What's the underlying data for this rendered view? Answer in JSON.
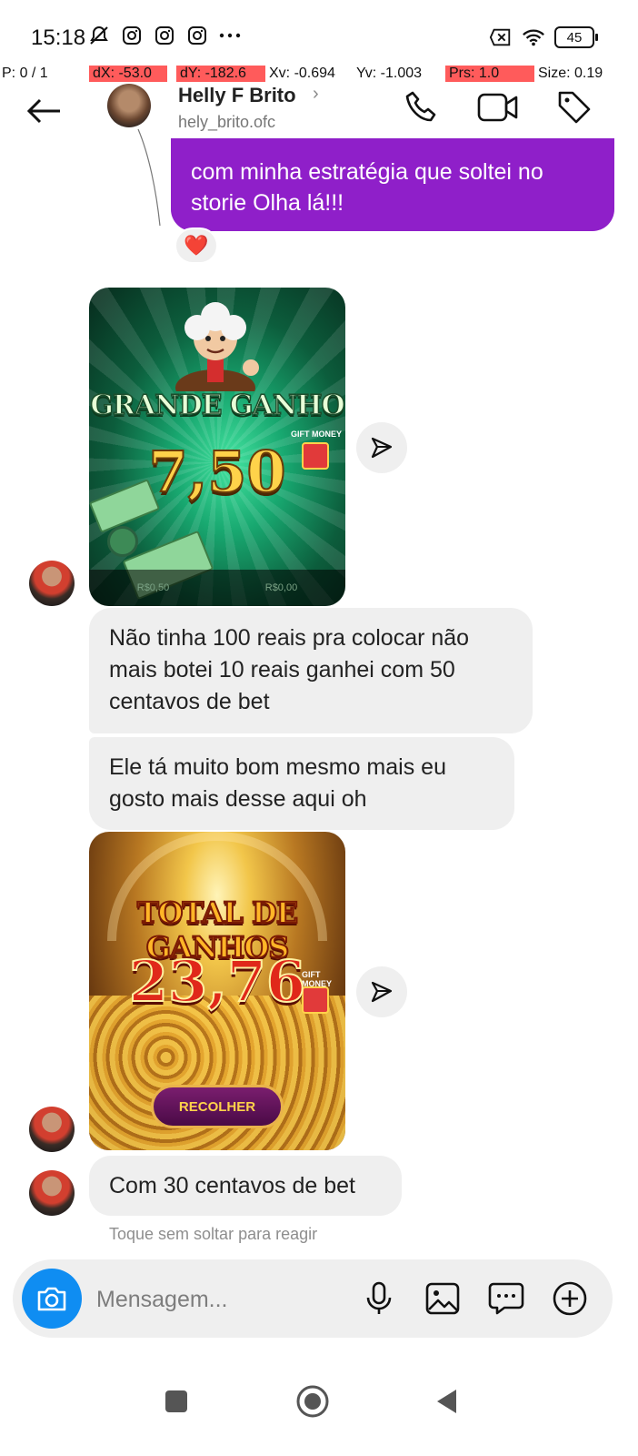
{
  "status_bar": {
    "time": "15:18",
    "battery": "45",
    "icons_left": [
      "notifications-off-icon",
      "instagram-icon",
      "instagram-icon",
      "instagram-icon",
      "more-dots-icon"
    ],
    "icons_right": [
      "sim-off-icon",
      "wifi-icon",
      "battery-icon"
    ]
  },
  "pointer_debug": {
    "p": "P: 0 / 1",
    "dx": "dX: -53.0",
    "dy": "dY: -182.6",
    "xv": "Xv: -0.694",
    "yv": "Yv: -1.003",
    "prs": "Prs: 1.0",
    "size": "Size: 0.19"
  },
  "header": {
    "name": "Helly F Brito",
    "chevron": "›",
    "handle": "hely_brito.ofc",
    "actions": [
      "phone-icon",
      "video-call-icon",
      "tag-icon"
    ]
  },
  "messages": {
    "outgoing_text": "com minha estratégia que soltei no storie Olha lá!!!",
    "reaction": "❤️",
    "image1": {
      "title": "GRANDE GANHO",
      "value": "7,50",
      "gift_label": "GIFT MONEY",
      "footer_left": "R$0,50",
      "footer_right": "R$0,00"
    },
    "bubble1": "Não tinha 100 reais pra colocar não mais botei 10 reais ganhei com 50 centavos de bet",
    "bubble2": "Ele tá muito bom mesmo mais eu gosto mais desse aqui oh",
    "image2": {
      "title": "TOTAL DE GANHOS",
      "value": "23,76",
      "gift_label": "GIFT MONEY",
      "button": "RECOLHER"
    },
    "bubble3": "Com 30 centavos de bet",
    "hint": "Toque sem soltar para reagir"
  },
  "composer": {
    "placeholder": "Mensagem...",
    "icons": [
      "microphone-icon",
      "gallery-icon",
      "sticker-chat-icon",
      "add-icon"
    ]
  },
  "colors": {
    "outgoing_bubble": "#8f1fc9",
    "incoming_bubble": "#efefef",
    "camera_button": "#0f8df2"
  }
}
